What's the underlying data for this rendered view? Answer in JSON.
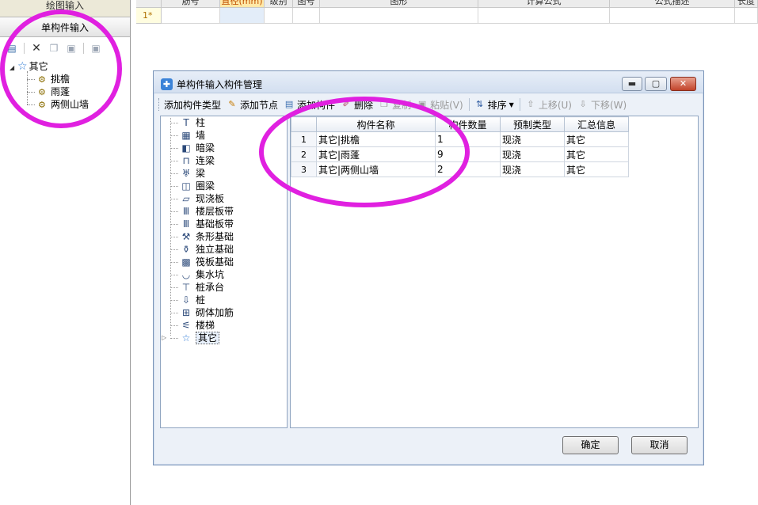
{
  "left_panel": {
    "tab_draw_label": "绘图输入",
    "tab_single_label": "单构件输入",
    "toolbar_icons": [
      "property-icon",
      "delete-icon",
      "copy-icon",
      "paste-icon",
      "paste-special-icon"
    ],
    "tree": {
      "root": "其它",
      "children": [
        "挑檐",
        "雨蓬",
        "两侧山墙"
      ]
    }
  },
  "top_grid": {
    "headers": [
      "筋号",
      "直径(mm)",
      "级别",
      "图号",
      "图形",
      "计算公式",
      "公式描述",
      "长度"
    ],
    "row_num": "1*"
  },
  "dialog": {
    "title": "单构件输入构件管理",
    "toolbar": {
      "add_type": "添加构件类型",
      "add_node": "添加节点",
      "add_component": "添加构件",
      "delete": "删除",
      "copy": "复制",
      "paste": "粘贴(V)",
      "sort": "排序",
      "move_up": "上移(U)",
      "move_down": "下移(W)"
    },
    "tree_items": [
      "柱",
      "墙",
      "暗梁",
      "连梁",
      "梁",
      "圈梁",
      "现浇板",
      "楼层板带",
      "基础板带",
      "条形基础",
      "独立基础",
      "筏板基础",
      "集水坑",
      "桩承台",
      "桩",
      "砌体加筋",
      "楼梯",
      "其它"
    ],
    "grid": {
      "columns": [
        "构件名称",
        "构件数量",
        "预制类型",
        "汇总信息"
      ],
      "rows": [
        {
          "num": "1",
          "name": "其它|挑檐",
          "count": "1",
          "type": "现浇",
          "summary": "其它"
        },
        {
          "num": "2",
          "name": "其它|雨蓬",
          "count": "9",
          "type": "现浇",
          "summary": "其它"
        },
        {
          "num": "3",
          "name": "其它|两侧山墙",
          "count": "2",
          "type": "现浇",
          "summary": "其它"
        }
      ]
    },
    "ok_label": "确定",
    "cancel_label": "取消"
  },
  "colors": {
    "annotation": "#e020e0",
    "dialog_bg": "#ecf1f8",
    "close_button": "#c2432a"
  }
}
